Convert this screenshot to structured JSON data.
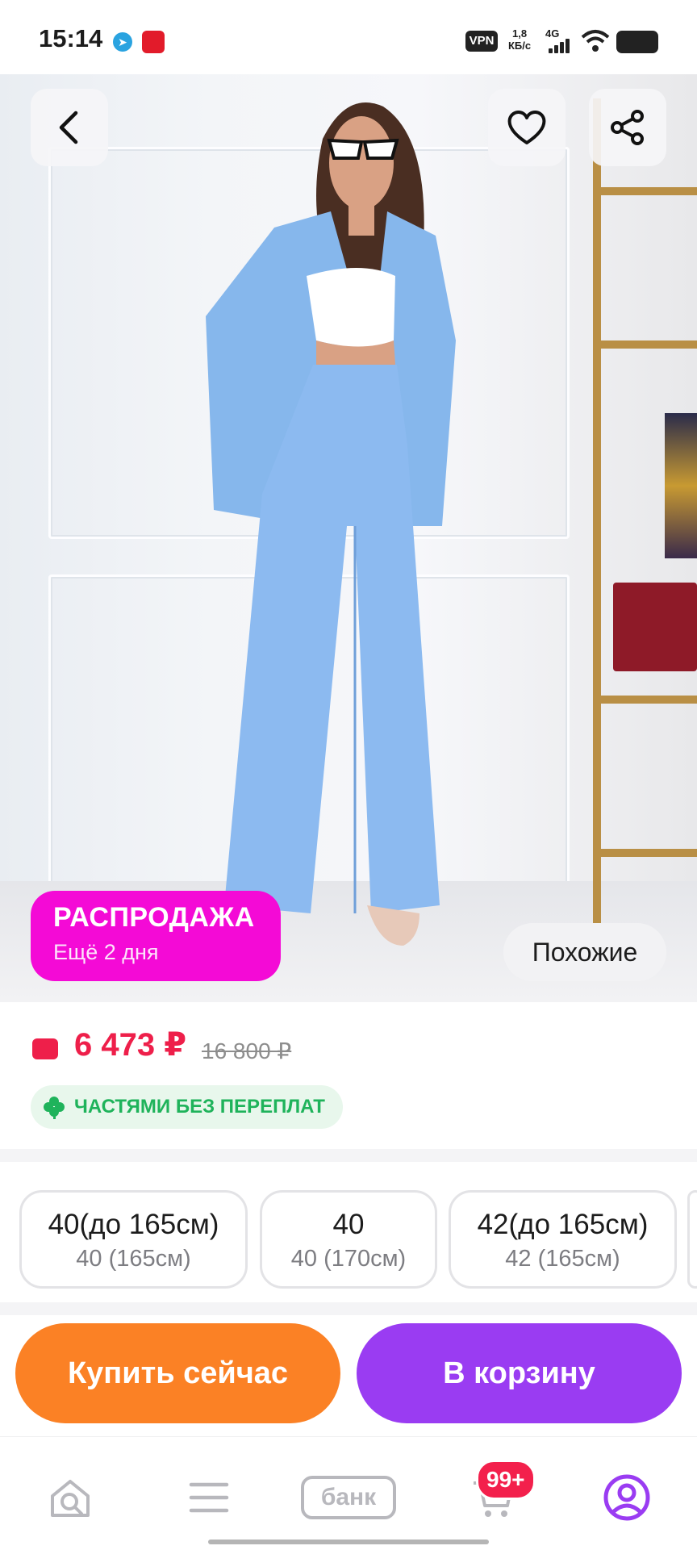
{
  "status_bar": {
    "time": "15:14",
    "vpn": "VPN",
    "speed_value": "1,8",
    "speed_unit": "КБ/с",
    "network": "4G"
  },
  "hero": {
    "sale_title": "РАСПРОДАЖА",
    "sale_subtitle": "Ещё 2 дня",
    "similar_label": "Похожие"
  },
  "price": {
    "current": "6 473 ₽",
    "old": "16 800 ₽",
    "installments": "ЧАСТЯМИ БЕЗ ПЕРЕПЛАТ"
  },
  "sizes": [
    {
      "size": "40(до 165см)",
      "detail": "40 (165см)"
    },
    {
      "size": "40",
      "detail": "40 (170см)"
    },
    {
      "size": "42(до 165см)",
      "detail": "42 (165см)"
    }
  ],
  "actions": {
    "buy_now": "Купить сейчас",
    "add_to_cart": "В корзину"
  },
  "nav": {
    "bank_label": "банк",
    "cart_badge": "99+"
  },
  "colors": {
    "sale_pink": "#f40ad6",
    "price_red": "#ee1f4a",
    "buy_orange": "#fb8125",
    "cart_purple": "#9a3cf2",
    "installment_green": "#1fb35b"
  }
}
